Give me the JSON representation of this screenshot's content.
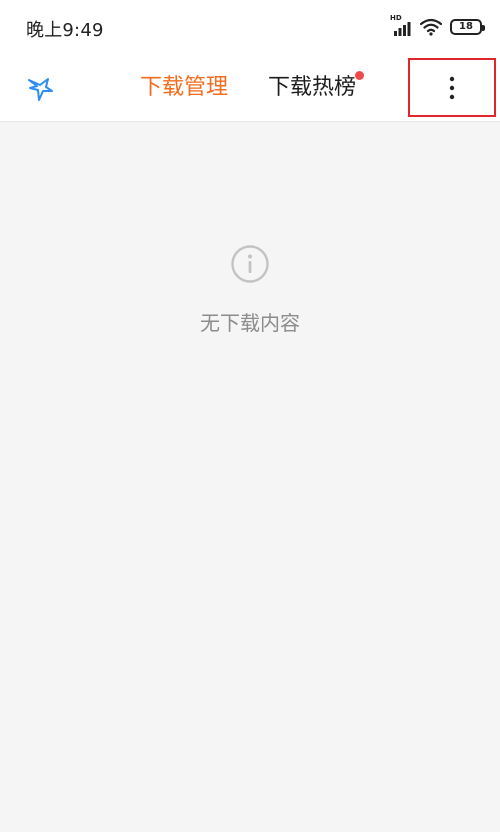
{
  "status_bar": {
    "time": "晚上9:49",
    "network_label": "HD",
    "battery_level": "18"
  },
  "header": {
    "logo_icon": "bird-logo-icon",
    "tabs": [
      {
        "label": "下载管理",
        "active": true
      },
      {
        "label": "下载热榜",
        "active": false,
        "has_notification_dot": true
      }
    ],
    "more_icon": "more-vertical-icon"
  },
  "main": {
    "empty_icon": "info-circle-icon",
    "empty_text": "无下载内容"
  },
  "colors": {
    "accent": "#f36b1c",
    "notification_dot": "#f24a4a",
    "highlight_box": "#e0262b",
    "logo": "#2b8ef0",
    "background": "#f5f5f5"
  }
}
